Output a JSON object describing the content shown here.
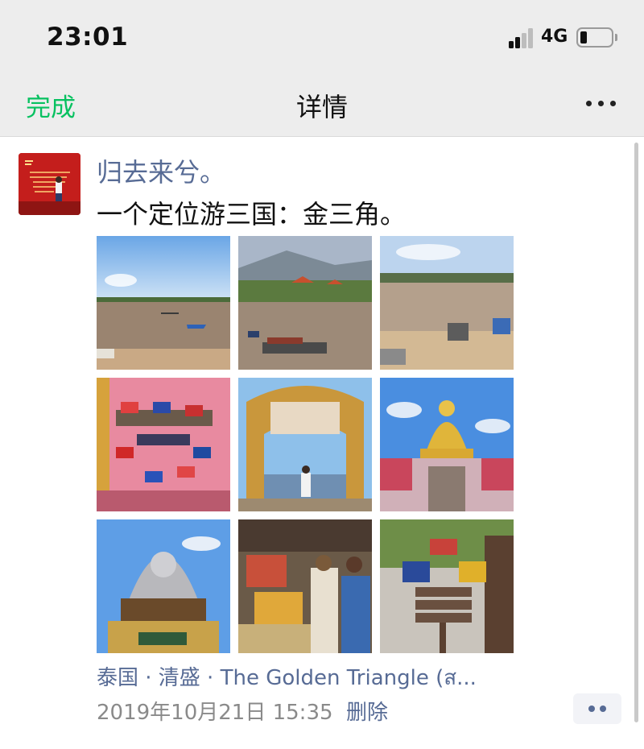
{
  "status_bar": {
    "time": "23:01",
    "network": "4G",
    "battery_level": 0.2
  },
  "nav": {
    "done_label": "完成",
    "title": "详情"
  },
  "post": {
    "username": "归去来兮。",
    "text": "一个定位游三国：金三角。",
    "location": "泰国 · 清盛 · The Golden Triangle (ส...",
    "timestamp": "2019年10月21日 15:35",
    "delete_label": "删除",
    "photo_count": 9
  },
  "colors": {
    "accent_green": "#07c160",
    "link_blue": "#576b95",
    "nav_background": "#ededed"
  },
  "icons": [
    "signal-icon",
    "battery-icon",
    "more-icon",
    "comment-icon"
  ]
}
